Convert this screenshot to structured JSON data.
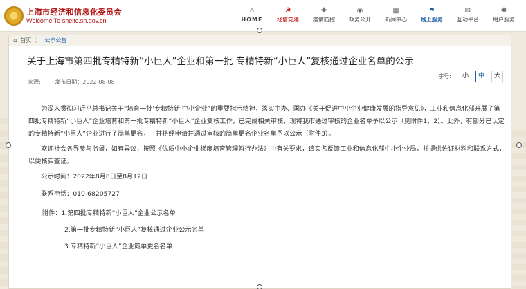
{
  "header": {
    "logo_cn": "上海市经济和信息化委员会",
    "logo_en": "Welcome To sheitc.sh.gov.cn",
    "nav": [
      {
        "label": "HOME",
        "icon": "⌂",
        "style": "home"
      },
      {
        "label": "经信党建",
        "icon": "☭",
        "style": "red"
      },
      {
        "label": "疫情防控",
        "icon": "✚",
        "style": ""
      },
      {
        "label": "政务公开",
        "icon": "◉",
        "style": ""
      },
      {
        "label": "新闻中心",
        "icon": "▦",
        "style": ""
      },
      {
        "label": "线上服务",
        "icon": "⚑",
        "style": "active"
      },
      {
        "label": "互动平台",
        "icon": "✉",
        "style": ""
      },
      {
        "label": "用户服务",
        "icon": "✱",
        "style": ""
      }
    ]
  },
  "breadcrumb": {
    "home": "首页",
    "sep": "〉",
    "current": "公示公告"
  },
  "article": {
    "title": "关于上海市第四批专精特新“小巨人”企业和第一批 专精特新“小巨人”复核通过企业名单的公示",
    "source_label": "来源:",
    "date_label": "发布日期：2022-08-08",
    "font_size_label": "字号:",
    "font_small": "小",
    "font_medium": "中",
    "font_large": "大",
    "para1": "为深入贯彻习近平总书记关于“培育一批‘专精特新’中小企业”的重要指示精神，落实中办、国办《关于促进中小企业健康发展的指导意见》，工业和信息化部开展了第四批专精特新“小巨人”企业培育和第一批专精特新“小巨人”企业复核工作，已完成相关审核，现将我市通过审核的企业名单予以公示（见附件1、2）。此外，有部分已认定的专精特新“小巨人”企业进行了简单更名，一并将经申请并通过审核的简单更名企业名单予以公示（附件3）。",
    "para2": "欢迎社会各界参与监督，如有异议，按照《优质中小企业梯度培育管理暂行办法》中有关要求，请实名反馈工业和信息化部中小企业局，并提供佐证材料和联系方式，以便核实查证。",
    "period": "公示时间：2022年8月8日至8月12日",
    "phone": "联系电话：010-68205727",
    "attach1": "附件：1.第四批专精特新“小巨人”企业公示名单",
    "attach2": "2.第一批专精特新“小巨人”复核通过企业公示名单",
    "attach3": "3.专精特新“小巨人”企业简单更名名单"
  }
}
